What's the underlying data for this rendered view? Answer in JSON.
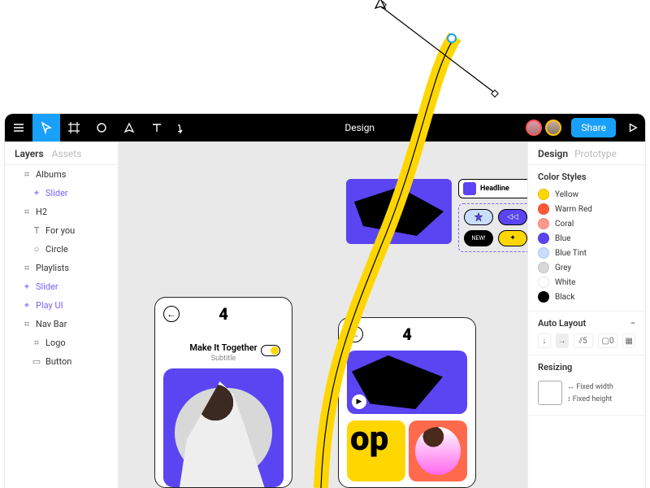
{
  "toolbar": {
    "title": "Design",
    "share": "Share"
  },
  "left": {
    "tab_layers": "Layers",
    "tab_assets": "Assets",
    "items": [
      {
        "label": "Albums"
      },
      {
        "label": "Slider"
      },
      {
        "label": "H2"
      },
      {
        "label": "For you"
      },
      {
        "label": "Circle"
      },
      {
        "label": "Playlists"
      },
      {
        "label": "Slider"
      },
      {
        "label": "Play UI"
      },
      {
        "label": "Nav Bar"
      },
      {
        "label": "Logo"
      },
      {
        "label": "Button"
      }
    ]
  },
  "right": {
    "tab_design": "Design",
    "tab_prototype": "Prototype",
    "color_styles_title": "Color Styles",
    "colors": [
      {
        "name": "Yellow",
        "hex": "#ffd600"
      },
      {
        "name": "Warm Red",
        "hex": "#ff5a36"
      },
      {
        "name": "Coral",
        "hex": "#ff9a8a"
      },
      {
        "name": "Blue",
        "hex": "#5b44f2"
      },
      {
        "name": "Blue Tint",
        "hex": "#c9ddff"
      },
      {
        "name": "Grey",
        "hex": "#d8d8d8"
      },
      {
        "name": "White",
        "hex": "#ffffff"
      },
      {
        "name": "Black",
        "hex": "#000000"
      }
    ],
    "auto_layout_title": "Auto Layout",
    "auto_layout_spacing": "5",
    "auto_layout_padding": "0",
    "resizing_title": "Resizing",
    "fixed_width": "Fixed width",
    "fixed_height": "Fixed height"
  },
  "canvas": {
    "headline_chip": "Headline",
    "new_pill": "NEW!",
    "artboard1": {
      "title": "Make It Together",
      "subtitle": "Subtitle"
    },
    "artboard2": {
      "tile2_text": "op"
    }
  }
}
